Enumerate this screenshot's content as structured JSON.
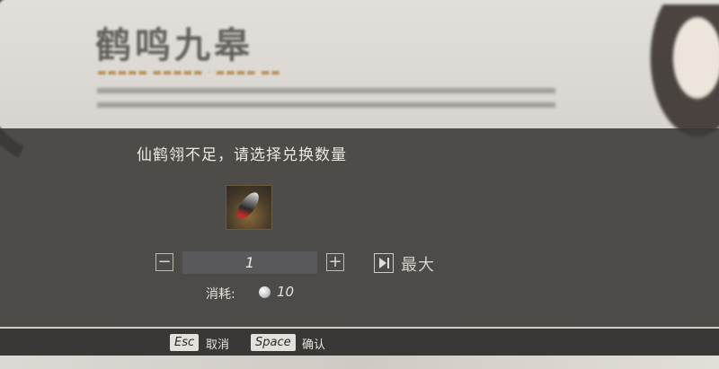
{
  "dialog": {
    "prompt": "仙鹤翎不足，请选择兑换数量",
    "item_icon": "crane-feather-icon",
    "quantity": "1",
    "decrease_icon": "minus-icon",
    "increase_icon": "plus-icon",
    "max_icon": "skip-to-end-icon",
    "max_label": "最大",
    "cost_label": "消耗:",
    "cost_icon": "pearl-currency-icon",
    "cost_value": "10"
  },
  "hints": {
    "cancel_key": "Esc",
    "cancel_label": "取消",
    "confirm_key": "Space",
    "confirm_label": "确认"
  },
  "background": {
    "title": "鹤鸣九皋"
  },
  "colors": {
    "modal_band": "#3a3937",
    "text": "#ece9e3",
    "key_cap": "#e4e1dc"
  }
}
